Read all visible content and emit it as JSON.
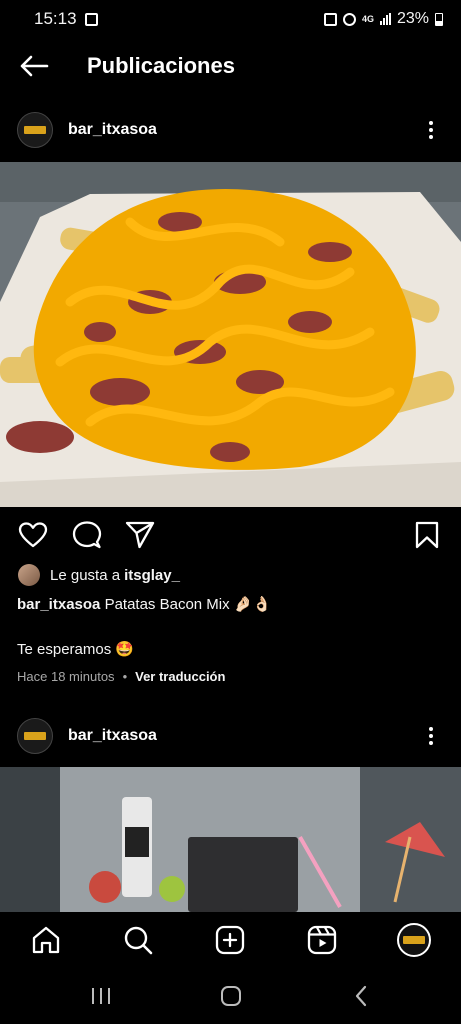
{
  "status_bar": {
    "time": "15:13",
    "network": "4G",
    "battery": "23%"
  },
  "header": {
    "title": "Publicaciones"
  },
  "post": {
    "username": "bar_itxasoa",
    "likes_prefix": "Le gusta a",
    "likes_user": "itsglay_",
    "caption_user": "bar_itxasoa",
    "caption_text": "Patatas Bacon Mix 🤌🏻👌🏻",
    "caption_line2": "Te esperamos 🤩",
    "time_ago": "Hace 18 minutos",
    "separator": "•",
    "translate_label": "Ver traducción"
  },
  "next_post": {
    "username": "bar_itxasoa"
  },
  "icons": {
    "back": "arrow-left-icon",
    "more": "more-vertical-icon",
    "like": "heart-icon",
    "comment": "comment-icon",
    "share": "send-icon",
    "save": "bookmark-icon",
    "home": "home-icon",
    "search": "search-icon",
    "create": "plus-square-icon",
    "reels": "reels-icon"
  },
  "colors": {
    "background": "#000000",
    "text": "#f5f5f5",
    "secondary_text": "#a8a8a8",
    "brand_badge": "#d9a21b"
  }
}
